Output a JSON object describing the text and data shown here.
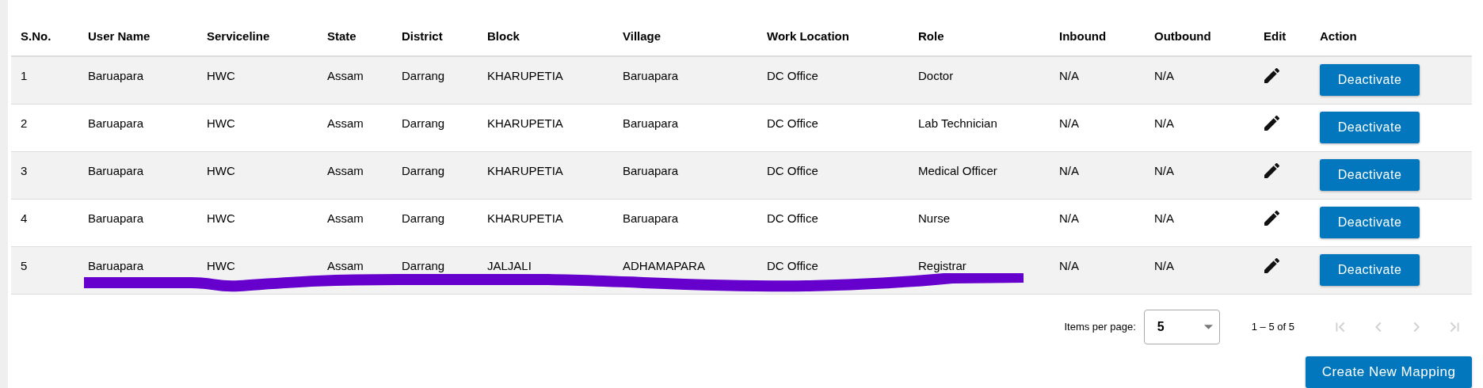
{
  "table": {
    "columns": [
      "S.No.",
      "User Name",
      "Serviceline",
      "State",
      "District",
      "Block",
      "Village",
      "Work Location",
      "Role",
      "Inbound",
      "Outbound",
      "Edit",
      "Action"
    ],
    "rows": [
      {
        "cells": [
          "1",
          "Baruapara",
          "HWC",
          "Assam",
          "Darrang",
          "KHARUPETIA",
          "Baruapara",
          "DC Office",
          "Doctor",
          "N/A",
          "N/A"
        ],
        "action": "Deactivate"
      },
      {
        "cells": [
          "2",
          "Baruapara",
          "HWC",
          "Assam",
          "Darrang",
          "KHARUPETIA",
          "Baruapara",
          "DC Office",
          "Lab Technician",
          "N/A",
          "N/A"
        ],
        "action": "Deactivate"
      },
      {
        "cells": [
          "3",
          "Baruapara",
          "HWC",
          "Assam",
          "Darrang",
          "KHARUPETIA",
          "Baruapara",
          "DC Office",
          "Medical Officer",
          "N/A",
          "N/A"
        ],
        "action": "Deactivate"
      },
      {
        "cells": [
          "4",
          "Baruapara",
          "HWC",
          "Assam",
          "Darrang",
          "KHARUPETIA",
          "Baruapara",
          "DC Office",
          "Nurse",
          "N/A",
          "N/A"
        ],
        "action": "Deactivate"
      },
      {
        "cells": [
          "5",
          "Baruapara",
          "HWC",
          "Assam",
          "Darrang",
          "JALJALI",
          "ADHAMAPARA",
          "DC Office",
          "Registrar",
          "N/A",
          "N/A"
        ],
        "action": "Deactivate"
      }
    ]
  },
  "paginator": {
    "items_per_page_label": "Items per page:",
    "page_size": "5",
    "range": "1 – 5 of 5",
    "nav": [
      {
        "kind": "first",
        "disabled": true
      },
      {
        "kind": "prev",
        "disabled": true
      },
      {
        "kind": "next",
        "disabled": true
      },
      {
        "kind": "last",
        "disabled": true
      }
    ]
  },
  "create_button": "Create New Mapping"
}
